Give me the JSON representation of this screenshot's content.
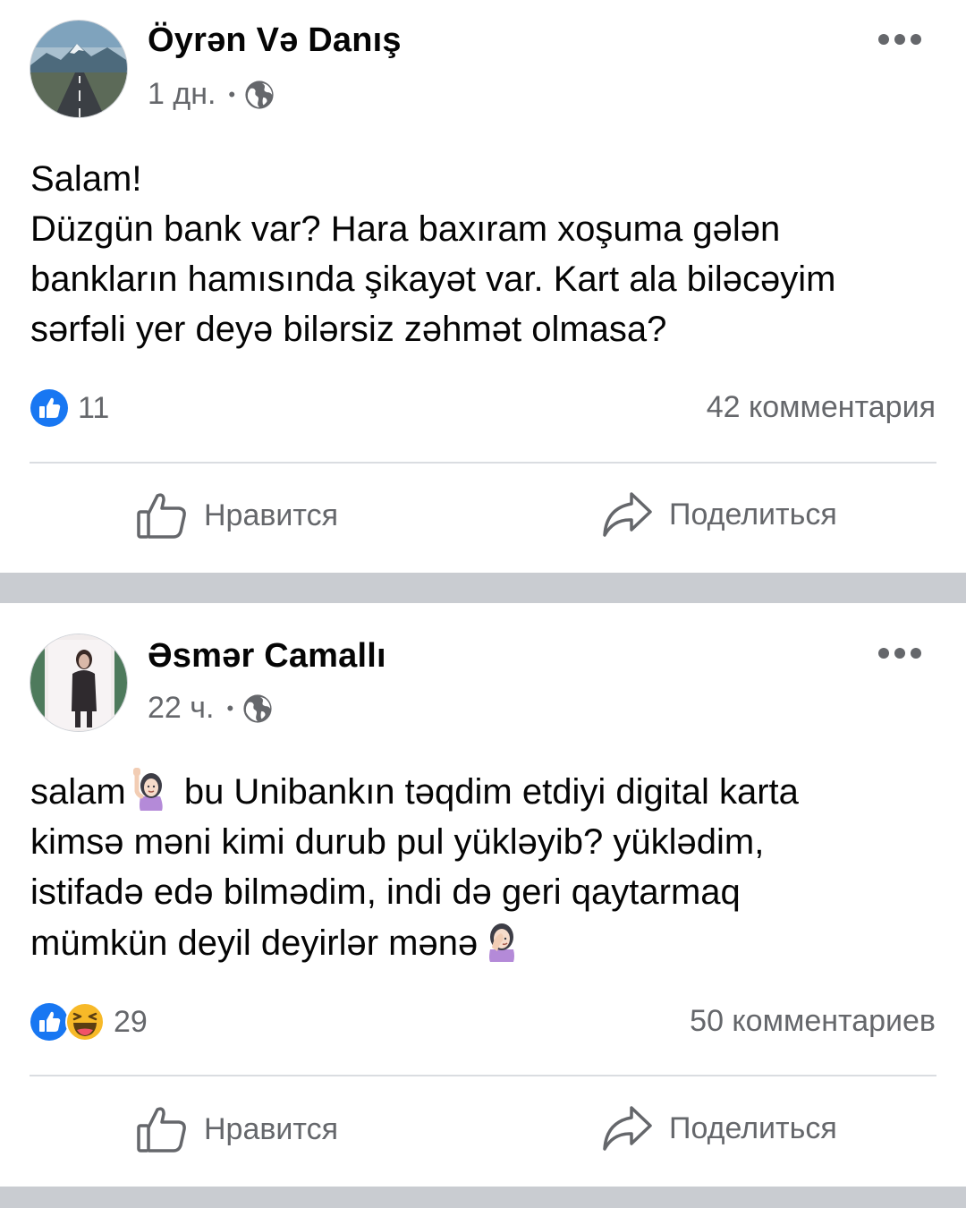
{
  "posts": [
    {
      "author": "Öyrən Və Danış",
      "time": "1 дн.",
      "text_lines": [
        "Salam!",
        "Düzgün bank var? Hara baxıram xoşuma gələn",
        "bankların hamısında şikayət var. Kart ala biləcəyim",
        "sərfəli yer deyə bilərsiz zəhmət olmasa?"
      ],
      "reaction_count": "11",
      "reaction_icons": [
        "like-reaction-icon"
      ],
      "comments": "42 комментария",
      "like_label": "Нравится",
      "share_label": "Поделиться"
    },
    {
      "author": "Əsmər Camallı",
      "time": "22 ч.",
      "text_lines": [
        "salam",
        "bu Unibankın təqdim etdiyi digital karta",
        "kimsə məni kimi durub pul yükləyib? yüklədim,",
        "istifadə edə bilmədim, indi də geri qaytarmaq",
        "mümkün deyil deyirlər mənə"
      ],
      "reaction_count": "29",
      "reaction_icons": [
        "like-reaction-icon",
        "haha-reaction-icon"
      ],
      "comments": "50 комментариев",
      "like_label": "Нравится",
      "share_label": "Поделиться"
    }
  ],
  "icons": {
    "privacy": "globe-icon",
    "menu": "more-options-icon",
    "like_action": "thumbs-up-outline-icon",
    "share_action": "share-arrow-icon",
    "emoji_1": "woman-raising-hand-emoji",
    "emoji_2": "woman-facepalming-emoji"
  },
  "colors": {
    "like_blue": "#1877f2",
    "haha_yellow": "#f7b928",
    "secondary_text": "#65676b",
    "separator": "#c9ccd1"
  }
}
